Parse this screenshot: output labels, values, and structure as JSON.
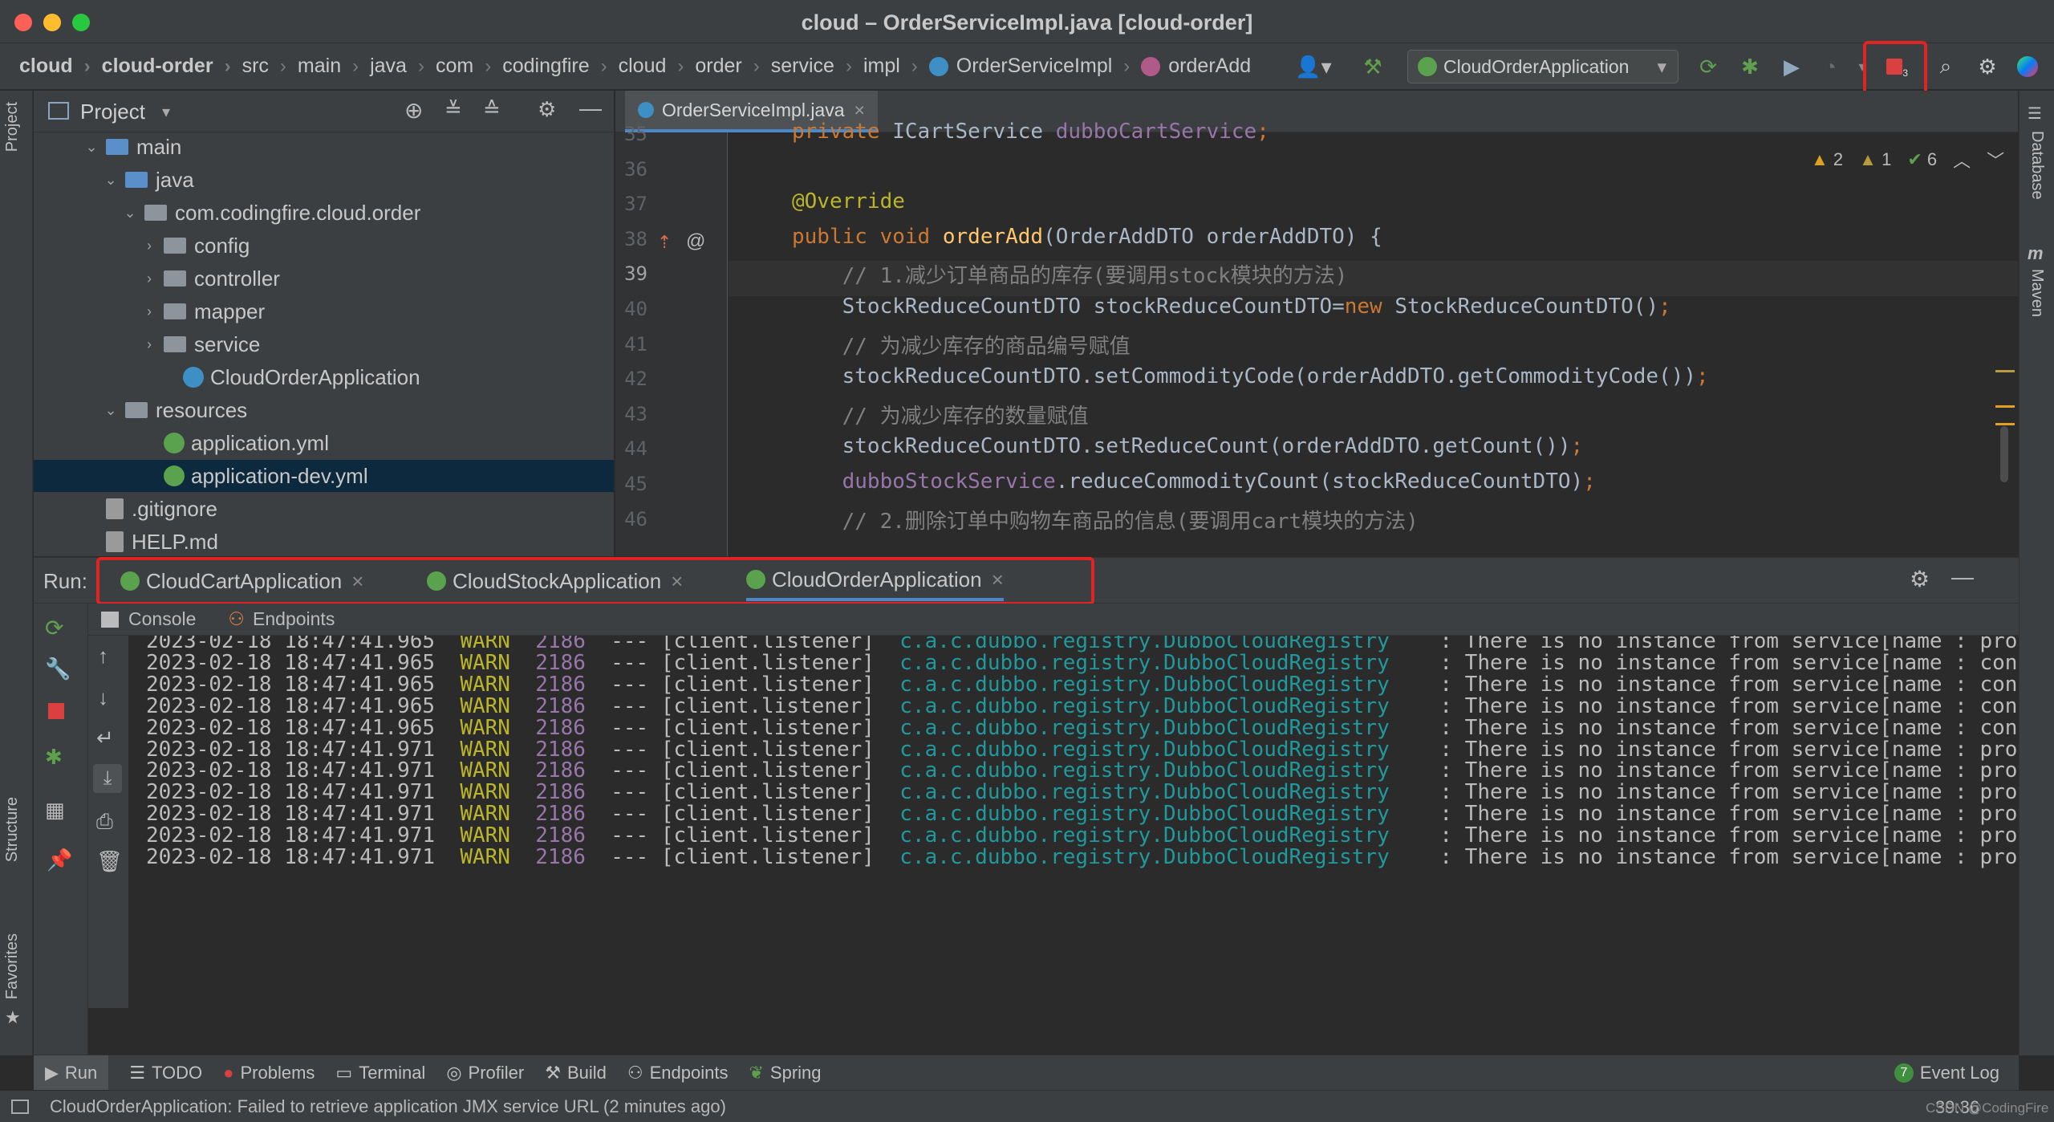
{
  "window": {
    "title": "cloud – OrderServiceImpl.java [cloud-order]"
  },
  "breadcrumb": [
    "cloud",
    "cloud-order",
    "src",
    "main",
    "java",
    "com",
    "codingfire",
    "cloud",
    "order",
    "service",
    "impl",
    "OrderServiceImpl",
    "orderAdd"
  ],
  "run_config": {
    "selected": "CloudOrderApplication"
  },
  "stop_badge": "3",
  "project_panel": {
    "title": "Project",
    "tree": [
      {
        "label": "main",
        "kind": "folder-blue",
        "indent": 3,
        "expanded": true
      },
      {
        "label": "java",
        "kind": "folder-blue",
        "indent": 4,
        "expanded": true
      },
      {
        "label": "com.codingfire.cloud.order",
        "kind": "folder-grey",
        "indent": 5,
        "expanded": true
      },
      {
        "label": "config",
        "kind": "folder-grey",
        "indent": 6,
        "expanded": false
      },
      {
        "label": "controller",
        "kind": "folder-grey",
        "indent": 6,
        "expanded": false
      },
      {
        "label": "mapper",
        "kind": "folder-grey",
        "indent": 6,
        "expanded": false
      },
      {
        "label": "service",
        "kind": "folder-grey",
        "indent": 6,
        "expanded": false
      },
      {
        "label": "CloudOrderApplication",
        "kind": "class",
        "indent": 7
      },
      {
        "label": "resources",
        "kind": "folder-grey",
        "indent": 4,
        "expanded": true
      },
      {
        "label": "application.yml",
        "kind": "yml",
        "indent": 6
      },
      {
        "label": "application-dev.yml",
        "kind": "yml",
        "indent": 6,
        "selected": true
      },
      {
        "label": ".gitignore",
        "kind": "file",
        "indent": 3
      },
      {
        "label": "HELP.md",
        "kind": "file",
        "indent": 3
      }
    ]
  },
  "editor": {
    "tab_label": "OrderServiceImpl.java",
    "inspections": {
      "errors": "2",
      "warnings": "1",
      "ok": "6"
    },
    "lines": [
      {
        "no": "35",
        "text": "private ICartService dubboCartService;"
      },
      {
        "no": "36",
        "text": ""
      },
      {
        "no": "37",
        "text": "@Override"
      },
      {
        "no": "38",
        "text": "public void orderAdd(OrderAddDTO orderAddDTO) {"
      },
      {
        "no": "39",
        "text": "    // 1.减少订单商品的库存(要调用stock模块的方法)"
      },
      {
        "no": "40",
        "text": "    StockReduceCountDTO stockReduceCountDTO=new StockReduceCountDTO();"
      },
      {
        "no": "41",
        "text": "    // 为减少库存的商品编号赋值"
      },
      {
        "no": "42",
        "text": "    stockReduceCountDTO.setCommodityCode(orderAddDTO.getCommodityCode());"
      },
      {
        "no": "43",
        "text": "    // 为减少库存的数量赋值"
      },
      {
        "no": "44",
        "text": "    stockReduceCountDTO.setReduceCount(orderAddDTO.getCount());"
      },
      {
        "no": "45",
        "text": "    dubboStockService.reduceCommodityCount(stockReduceCountDTO);"
      },
      {
        "no": "46",
        "text": "    // 2.删除订单中购物车商品的信息(要调用cart模块的方法)"
      }
    ]
  },
  "run_panel": {
    "label": "Run:",
    "tabs": [
      "CloudCartApplication",
      "CloudStockApplication",
      "CloudOrderApplication"
    ],
    "subtabs": [
      "Console",
      "Endpoints"
    ],
    "log": [
      {
        "ts": "2023-02-18 18:47:41.965",
        "level": "WARN",
        "pid": "2186",
        "thread": "--- [client.listener]",
        "logger": "c.a.c.dubbo.registry.DubboCloudRegistry",
        "msg": "  : There is no instance from service[name : provi"
      },
      {
        "ts": "2023-02-18 18:47:41.965",
        "level": "WARN",
        "pid": "2186",
        "thread": "--- [client.listener]",
        "logger": "c.a.c.dubbo.registry.DubboCloudRegistry",
        "msg": "  : There is no instance from service[name : consu"
      },
      {
        "ts": "2023-02-18 18:47:41.965",
        "level": "WARN",
        "pid": "2186",
        "thread": "--- [client.listener]",
        "logger": "c.a.c.dubbo.registry.DubboCloudRegistry",
        "msg": "  : There is no instance from service[name : consu"
      },
      {
        "ts": "2023-02-18 18:47:41.965",
        "level": "WARN",
        "pid": "2186",
        "thread": "--- [client.listener]",
        "logger": "c.a.c.dubbo.registry.DubboCloudRegistry",
        "msg": "  : There is no instance from service[name : consu"
      },
      {
        "ts": "2023-02-18 18:47:41.965",
        "level": "WARN",
        "pid": "2186",
        "thread": "--- [client.listener]",
        "logger": "c.a.c.dubbo.registry.DubboCloudRegistry",
        "msg": "  : There is no instance from service[name : consu"
      },
      {
        "ts": "2023-02-18 18:47:41.971",
        "level": "WARN",
        "pid": "2186",
        "thread": "--- [client.listener]",
        "logger": "c.a.c.dubbo.registry.DubboCloudRegistry",
        "msg": "  : There is no instance from service[name : provi"
      },
      {
        "ts": "2023-02-18 18:47:41.971",
        "level": "WARN",
        "pid": "2186",
        "thread": "--- [client.listener]",
        "logger": "c.a.c.dubbo.registry.DubboCloudRegistry",
        "msg": "  : There is no instance from service[name : provi"
      },
      {
        "ts": "2023-02-18 18:47:41.971",
        "level": "WARN",
        "pid": "2186",
        "thread": "--- [client.listener]",
        "logger": "c.a.c.dubbo.registry.DubboCloudRegistry",
        "msg": "  : There is no instance from service[name : provi"
      },
      {
        "ts": "2023-02-18 18:47:41.971",
        "level": "WARN",
        "pid": "2186",
        "thread": "--- [client.listener]",
        "logger": "c.a.c.dubbo.registry.DubboCloudRegistry",
        "msg": "  : There is no instance from service[name : provi"
      },
      {
        "ts": "2023-02-18 18:47:41.971",
        "level": "WARN",
        "pid": "2186",
        "thread": "--- [client.listener]",
        "logger": "c.a.c.dubbo.registry.DubboCloudRegistry",
        "msg": "  : There is no instance from service[name : provi"
      },
      {
        "ts": "2023-02-18 18:47:41.971",
        "level": "WARN",
        "pid": "2186",
        "thread": "--- [client.listener]",
        "logger": "c.a.c.dubbo.registry.DubboCloudRegistry",
        "msg": "  : There is no instance from service[name : provi"
      }
    ]
  },
  "bottom_tools": [
    "Run",
    "TODO",
    "Problems",
    "Terminal",
    "Profiler",
    "Build",
    "Endpoints",
    "Spring"
  ],
  "event_log": {
    "count": "7",
    "label": "Event Log"
  },
  "left_tabs": [
    "Project",
    "Structure",
    "Favorites"
  ],
  "right_tabs": [
    "Database",
    "Maven"
  ],
  "status": {
    "message": "CloudOrderApplication: Failed to retrieve application JMX service URL (2 minutes ago)",
    "position": "39:36",
    "watermark": "CSDN @CodingFire"
  },
  "colors": {
    "accent": "#4a88c7",
    "highlight_box": "#e02424",
    "warn": "#bbb529"
  }
}
